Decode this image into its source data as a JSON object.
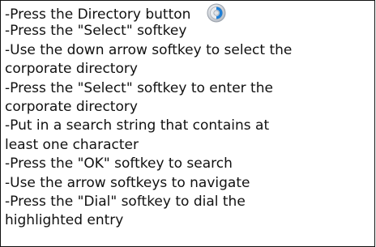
{
  "instructions": [
    "-Press the Directory button",
    "-Press the \"Select\" softkey",
    "-Use the down arrow softkey to select the",
    "corporate directory",
    "-Press the \"Select\" softkey to enter the",
    "corporate directory",
    "-Put in a search string that contains at",
    "least one character",
    "-Press the \"OK\" softkey to search",
    "-Use the arrow softkeys to navigate",
    "-Press the \"Dial\" softkey to dial the",
    "highlighted entry"
  ],
  "icon": "directory-button-icon",
  "colors": {
    "text": "#111111",
    "border": "#111111",
    "icon_blue": "#1f7fd6",
    "icon_gray": "#c9cdd3"
  }
}
